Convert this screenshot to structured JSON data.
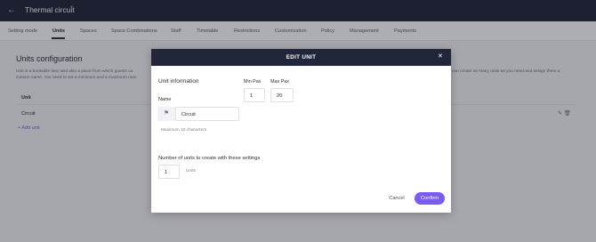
{
  "header": {
    "back_icon": "arrow-left-icon",
    "title": "Thermal circuit",
    "caret": "⌃"
  },
  "tabs": [
    {
      "label": "Setting mode",
      "active": false
    },
    {
      "label": "Units",
      "active": true
    },
    {
      "label": "Spaces",
      "active": false
    },
    {
      "label": "Space Combinations",
      "active": false
    },
    {
      "label": "Staff",
      "active": false
    },
    {
      "label": "Timetable",
      "active": false
    },
    {
      "label": "Restrictions",
      "active": false
    },
    {
      "label": "Customization",
      "active": false
    },
    {
      "label": "Policy",
      "active": false
    },
    {
      "label": "Management",
      "active": false
    },
    {
      "label": "Payments",
      "active": false
    }
  ],
  "main": {
    "heading": "Units configuration",
    "desc_line1": "Unit is a bookable item and also a place from which guests ca",
    "desc_line2": "custom name. You need to set a minimum and a maximum num",
    "desc_right": "can create as many units as you need and assign them a",
    "column_header": "Unit",
    "row_value": "Circuit",
    "add_link": "+ Add unit"
  },
  "modal": {
    "title": "EDIT UNIT",
    "close_icon": "close-icon",
    "unit_info_title": "Unit information",
    "name_label": "Name",
    "name_value": "Circuit",
    "flag_icon": "flag-icon",
    "name_hint": "Maximum 10 characters",
    "min_pax_label": "Min Pax",
    "min_pax_value": "1",
    "max_pax_label": "Max Pax",
    "max_pax_value": "20",
    "units_count_title": "Number of units to create with these settings",
    "units_count_value": "1",
    "units_suffix": "Units",
    "cancel_label": "Cancel",
    "confirm_label": "Confirm"
  },
  "colors": {
    "accent": "#7b5cf0",
    "header_bg": "#22263a"
  }
}
